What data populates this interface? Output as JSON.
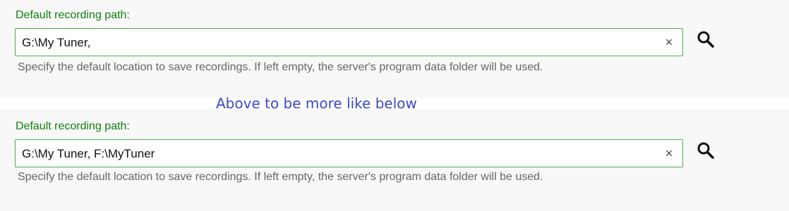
{
  "top_section": {
    "label": "Default recording path:",
    "input_value": "G:\\My Tuner,",
    "clear_glyph": "×",
    "help_text": "Specify the default location to save recordings. If left empty, the server's program data folder will be used."
  },
  "annotation": {
    "text": "Above to be more like below",
    "color": "#3a4bc8"
  },
  "bottom_section": {
    "label": "Default recording path:",
    "input_value": "G:\\My Tuner, F:\\MyTuner",
    "clear_glyph": "×",
    "help_text": "Specify the default location to save recordings. If left empty, the server's program data folder will be used."
  },
  "icons": {
    "search": "search-icon",
    "clear": "close-icon"
  },
  "colors": {
    "label": "#108010",
    "field_border": "#4cae4c",
    "help_text": "#666666",
    "background": "#f8f8f8"
  }
}
